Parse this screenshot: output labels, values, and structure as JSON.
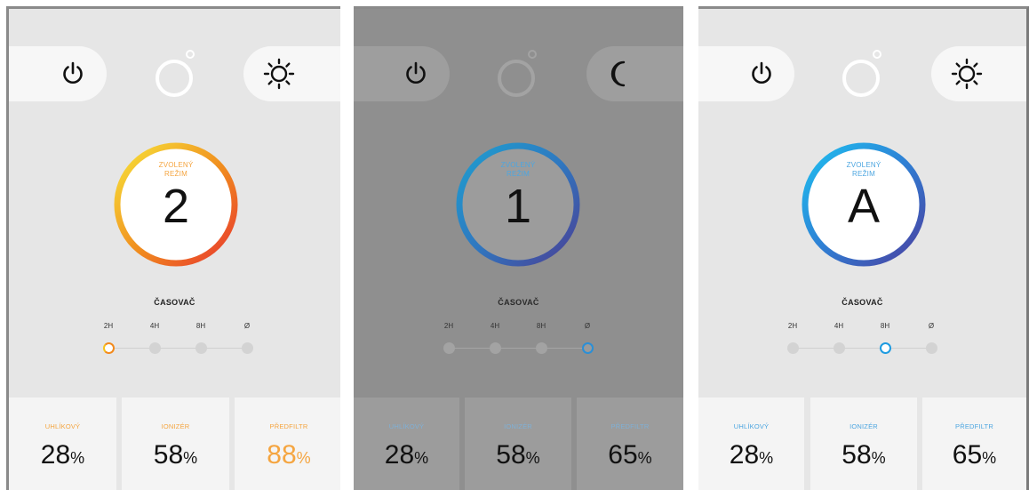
{
  "colors": {
    "panel_background": "#e6e6e6",
    "dimmed_panel_background": "#8f8f8f",
    "orange_accent": "#f5a540",
    "blue_accent": "#4da6e0",
    "ring_gradient_warm": [
      "#f7e43a",
      "#f08a1e",
      "#e8352f"
    ],
    "ring_gradient_cool": [
      "#1ec0f0",
      "#2f7fd4",
      "#4b3fa0"
    ]
  },
  "panels": [
    {
      "state": "active",
      "top_bar": {
        "power_icon": "power-icon",
        "sensor_icon": "ring-sensor-icon",
        "mode_icon": "sun-icon"
      },
      "mode": {
        "label_line1": "ZVOLENÝ",
        "label_line2": "REŽIM",
        "value": "2",
        "ring": "warm"
      },
      "timer": {
        "title": "ČASOVAČ",
        "options": [
          "2H",
          "4H",
          "8H",
          "Ø"
        ],
        "selected": "2H"
      },
      "stats": [
        {
          "label": "UHLÍKOVÝ",
          "value": "28",
          "unit": "%"
        },
        {
          "label": "IONIZÉR",
          "value": "58",
          "unit": "%"
        },
        {
          "label": "PŘEDFILTR",
          "value": "88",
          "unit": "%"
        }
      ]
    },
    {
      "state": "dimmed",
      "top_bar": {
        "power_icon": "power-icon",
        "sensor_icon": "ring-sensor-icon",
        "mode_icon": "moon-icon"
      },
      "mode": {
        "label_line1": "ZVOLENÝ",
        "label_line2": "REŽIM",
        "value": "1",
        "ring": "cool"
      },
      "timer": {
        "title": "ČASOVAČ",
        "options": [
          "2H",
          "4H",
          "8H",
          "Ø"
        ],
        "selected": "Ø"
      },
      "stats": [
        {
          "label": "UHLÍKOVÝ",
          "value": "28",
          "unit": "%"
        },
        {
          "label": "IONIZÉR",
          "value": "58",
          "unit": "%"
        },
        {
          "label": "PŘEDFILTR",
          "value": "65",
          "unit": "%"
        }
      ]
    },
    {
      "state": "active",
      "top_bar": {
        "power_icon": "power-icon",
        "sensor_icon": "ring-sensor-icon",
        "mode_icon": "sun-icon"
      },
      "mode": {
        "label_line1": "ZVOLENÝ",
        "label_line2": "REŽIM",
        "value": "A",
        "ring": "cool"
      },
      "timer": {
        "title": "ČASOVAČ",
        "options": [
          "2H",
          "4H",
          "8H",
          "Ø"
        ],
        "selected": "8H"
      },
      "stats": [
        {
          "label": "UHLÍKOVÝ",
          "value": "28",
          "unit": "%"
        },
        {
          "label": "IONIZÉR",
          "value": "58",
          "unit": "%"
        },
        {
          "label": "PŘEDFILTR",
          "value": "65",
          "unit": "%"
        }
      ]
    }
  ]
}
